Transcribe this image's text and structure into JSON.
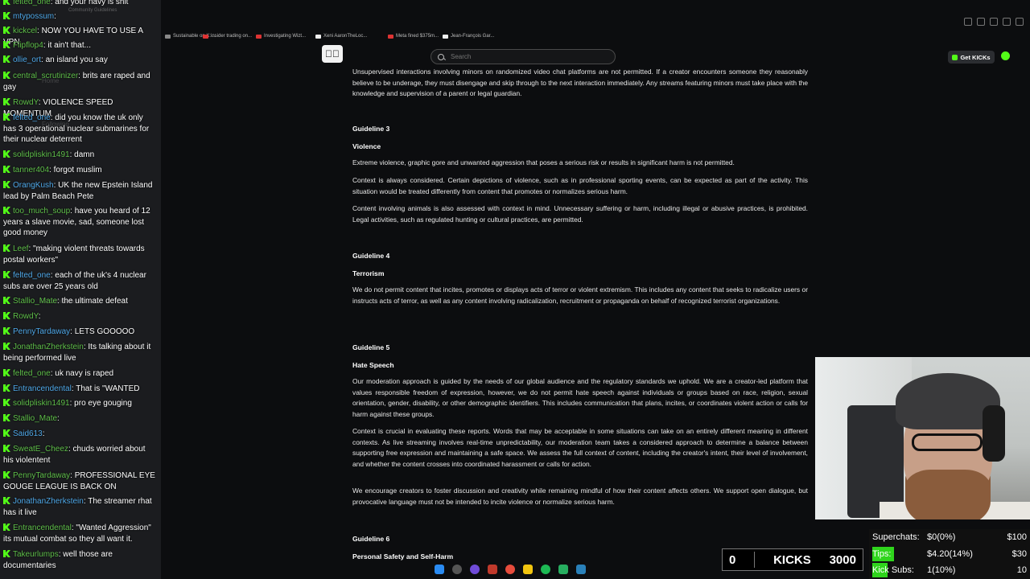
{
  "chat": {
    "messages": [
      {
        "user": "felted_one",
        "text": "and your navy is shit"
      },
      {
        "user": "mtypossum",
        "text": ""
      },
      {
        "user": "kickcel",
        "text": "NOW YOU HAVE TO USE A VPN"
      },
      {
        "user": "Flipflop4",
        "text": "it ain't that..."
      },
      {
        "user": "ollie_ort",
        "text": "an island you say"
      },
      {
        "user": "central_scrutinizer",
        "text": "brits are raped and gay"
      },
      {
        "user": "RowdY",
        "text": "VIOLENCE SPEED MOMENTUM"
      },
      {
        "user": "felted_one",
        "text": "did you know the uk only has 3 operational nuclear submarines for their nuclear deterrent"
      },
      {
        "user": "solidpliskin1491",
        "text": "damn"
      },
      {
        "user": "tanner404",
        "text": "forgot muslim"
      },
      {
        "user": "OrangKush",
        "text": "UK the new Epstein Island lead by Palm Beach Pete"
      },
      {
        "user": "too_much_soup",
        "text": "have you heard of 12 years a slave movie, sad, someone lost good money"
      },
      {
        "user": "Leef",
        "text": "\"making violent threats towards postal workers\""
      },
      {
        "user": "felted_one",
        "text": "each of the uk's 4 nuclear subs are over 25 years old"
      },
      {
        "user": "Stallio_Mate",
        "text": "the ultimate defeat"
      },
      {
        "user": "RowdY",
        "text": ""
      },
      {
        "user": "PennyTardaway",
        "text": "LETS GOOOOO"
      },
      {
        "user": "JonathanZherkstein",
        "text": "Its talking about it being performed live"
      },
      {
        "user": "felted_one",
        "text": "uk navy is raped"
      },
      {
        "user": "Entrancendental",
        "text": "That is \"WANTED"
      },
      {
        "user": "solidpliskin1491",
        "text": "pro eye gouging"
      },
      {
        "user": "Stallio_Mate",
        "text": ""
      },
      {
        "user": "Said613",
        "text": ""
      },
      {
        "user": "SweatE_Cheez",
        "text": "chuds worried about his violentent"
      },
      {
        "user": "PennyTardaway",
        "text": "PROFESSIONAL EYE GOUGE LEAGUE IS BACK ON"
      },
      {
        "user": "JonathanZherkstein",
        "text": "The streamer rhat has it live"
      },
      {
        "user": "Entrancendental",
        "text": "\"Wanted Aggression\" its mutual combat so they all want it."
      },
      {
        "user": "Takeurlumps",
        "text": "well those are documentaries"
      }
    ]
  },
  "browser": {
    "tabs": [
      "Community Guidelines",
      "Sustainable on X: ...",
      "insider trading on...",
      "Investigating Wizt...",
      "Xeni AaronTheLoc...",
      "Meta fined $375m...",
      "Jean-François Gar..."
    ]
  },
  "header": {
    "search_placeholder": "Search",
    "get_kicks_label": "Get KICKs"
  },
  "doc": {
    "intro": "Unsupervised interactions involving minors on randomized video chat platforms are not permitted. If a creator encounters someone they reasonably believe to be underage, they must disengage and skip through to the next interaction immediately. Any streams featuring minors must take place with the knowledge and supervision of a parent or legal guardian.",
    "g3_number": "Guideline 3",
    "g3_title": "Violence",
    "g3_p1": "Extreme violence, graphic gore and unwanted aggression that poses a serious risk or results in significant harm is not permitted.",
    "g3_p2": "Context is always considered. Certain depictions of violence, such as in professional sporting events, can be expected as part of the activity. This situation would be treated differently from content that promotes or normalizes serious harm.",
    "g3_p3": "Content involving animals is also assessed with context in mind. Unnecessary suffering or harm, including illegal or abusive practices, is prohibited. Legal activities, such as regulated hunting or cultural practices, are permitted.",
    "g4_number": "Guideline 4",
    "g4_title": "Terrorism",
    "g4_p1": "We do not permit content that incites, promotes or displays acts of terror or violent extremism. This includes any content that seeks to radicalize users or instructs acts of terror, as well as any content involving radicalization, recruitment or propaganda on behalf of recognized terrorist organizations.",
    "g5_number": "Guideline 5",
    "g5_title": "Hate Speech",
    "g5_p1": "Our moderation approach is guided by the needs of our global audience and the regulatory standards we uphold. We are a creator-led platform that values responsible freedom of expression, however, we do not permit hate speech against individuals or groups based on race, religion, sexual orientation, gender, disability, or other demographic identifiers. This includes communication that plans, incites, or coordinates violent action or calls for harm against these groups.",
    "g5_p2": "Context is crucial in evaluating these reports. Words that may be acceptable in some situations can take on an entirely different meaning in different contexts. As live streaming involves real-time unpredictability, our moderation team takes a considered approach to determine a balance between supporting free expression and maintaining a safe space. We assess the full context of content, including the creator's intent, their level of involvement, and whether the content crosses into coordinated harassment or calls for action.",
    "g5_p3": "We encourage creators to foster discussion and creativity while remaining mindful of how their content affects others. We support open dialogue, but provocative language must not be intended to incite violence or normalize serious harm.",
    "g6_number": "Guideline 6",
    "g6_title": "Personal Safety and Self-Harm"
  },
  "kicks": {
    "current": "0",
    "label": "KICKS",
    "goal": "3000"
  },
  "goals": [
    {
      "label": "Superchats:",
      "value": "$0(0%)",
      "target": "$100",
      "progress": 0
    },
    {
      "label": "Tips:",
      "value": "$4.20(14%)",
      "target": "$30",
      "progress": 0.14
    },
    {
      "label": "Kick Subs:",
      "value": "1(10%)",
      "target": "10",
      "progress": 0.1
    }
  ],
  "colors": {
    "kick_green": "#53fc18",
    "goal_fill": "#2fd51c",
    "chat_username": "#5fbf4a"
  }
}
